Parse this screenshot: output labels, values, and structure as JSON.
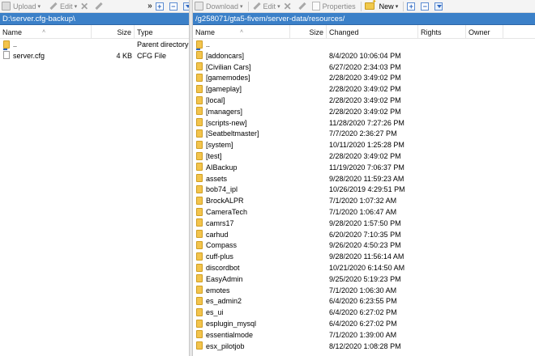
{
  "left": {
    "toolbar": {
      "upload": "Upload",
      "edit": "Edit"
    },
    "path": "D:\\server.cfg-backup\\",
    "columns": {
      "name": "Name",
      "size": "Size",
      "type": "Type"
    },
    "rows": [
      {
        "name": "..",
        "size": "",
        "type": "Parent directory",
        "icon": "up-folder-icon"
      },
      {
        "name": "server.cfg",
        "size": "4 KB",
        "type": "CFG File",
        "icon": "file-icon"
      }
    ]
  },
  "right": {
    "toolbar": {
      "download": "Download",
      "edit": "Edit",
      "properties": "Properties",
      "new": "New"
    },
    "path": "/g258071/gta5-fivem/server-data/resources/",
    "columns": {
      "name": "Name",
      "size": "Size",
      "changed": "Changed",
      "rights": "Rights",
      "owner": "Owner"
    },
    "rows": [
      {
        "name": "..",
        "changed": ""
      },
      {
        "name": "[addoncars]",
        "changed": "8/4/2020 10:06:04 PM"
      },
      {
        "name": "[Civilian Cars]",
        "changed": "6/27/2020 2:34:03 PM"
      },
      {
        "name": "[gamemodes]",
        "changed": "2/28/2020 3:49:02 PM"
      },
      {
        "name": "[gameplay]",
        "changed": "2/28/2020 3:49:02 PM"
      },
      {
        "name": "[local]",
        "changed": "2/28/2020 3:49:02 PM"
      },
      {
        "name": "[managers]",
        "changed": "2/28/2020 3:49:02 PM"
      },
      {
        "name": "[scripts-new]",
        "changed": "11/28/2020 7:27:26 PM"
      },
      {
        "name": "[Seatbeltmaster]",
        "changed": "7/7/2020 2:36:27 PM"
      },
      {
        "name": "[system]",
        "changed": "10/11/2020 1:25:28 PM"
      },
      {
        "name": "[test]",
        "changed": "2/28/2020 3:49:02 PM"
      },
      {
        "name": "AIBackup",
        "changed": "11/19/2020 7:06:37 PM"
      },
      {
        "name": "assets",
        "changed": "9/28/2020 11:59:23 AM"
      },
      {
        "name": "bob74_ipl",
        "changed": "10/26/2019 4:29:51 PM"
      },
      {
        "name": "BrockALPR",
        "changed": "7/1/2020 1:07:32 AM"
      },
      {
        "name": "CameraTech",
        "changed": "7/1/2020 1:06:47 AM"
      },
      {
        "name": "camrs17",
        "changed": "9/28/2020 1:57:50 PM"
      },
      {
        "name": "carhud",
        "changed": "6/20/2020 7:10:35 PM"
      },
      {
        "name": "Compass",
        "changed": "9/26/2020 4:50:23 PM"
      },
      {
        "name": "cuff-plus",
        "changed": "9/28/2020 11:56:14 AM"
      },
      {
        "name": "discordbot",
        "changed": "10/21/2020 6:14:50 AM"
      },
      {
        "name": "EasyAdmin",
        "changed": "9/25/2020 5:19:23 PM"
      },
      {
        "name": "emotes",
        "changed": "7/1/2020 1:06:30 AM"
      },
      {
        "name": "es_admin2",
        "changed": "6/4/2020 6:23:55 PM"
      },
      {
        "name": "es_ui",
        "changed": "6/4/2020 6:27:02 PM"
      },
      {
        "name": "esplugin_mysql",
        "changed": "6/4/2020 6:27:02 PM"
      },
      {
        "name": "essentialmode",
        "changed": "7/1/2020 1:39:00 AM"
      },
      {
        "name": "esx_pilotjob",
        "changed": "8/12/2020 1:08:28 PM"
      }
    ]
  }
}
